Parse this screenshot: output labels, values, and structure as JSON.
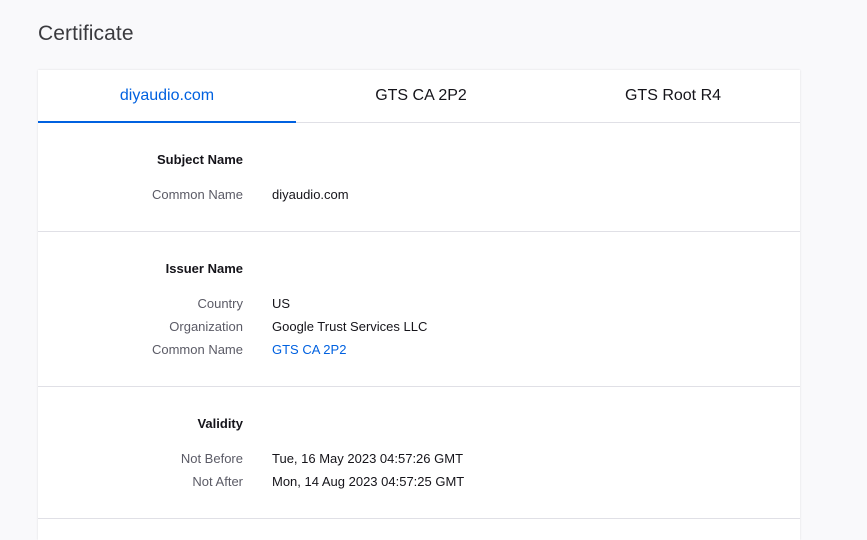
{
  "page": {
    "title": "Certificate"
  },
  "tabs": [
    {
      "label": "diyaudio.com",
      "active": true
    },
    {
      "label": "GTS CA 2P2",
      "active": false
    },
    {
      "label": "GTS Root R4",
      "active": false
    }
  ],
  "subject": {
    "heading": "Subject Name",
    "common_name": {
      "label": "Common Name",
      "value": "diyaudio.com"
    }
  },
  "issuer": {
    "heading": "Issuer Name",
    "country": {
      "label": "Country",
      "value": "US"
    },
    "organization": {
      "label": "Organization",
      "value": "Google Trust Services LLC"
    },
    "common_name": {
      "label": "Common Name",
      "value": "GTS CA 2P2"
    }
  },
  "validity": {
    "heading": "Validity",
    "not_before": {
      "label": "Not Before",
      "value": "Tue, 16 May 2023 04:57:26 GMT"
    },
    "not_after": {
      "label": "Not After",
      "value": "Mon, 14 Aug 2023 04:57:25 GMT"
    }
  },
  "colors": {
    "accent": "#0061e0",
    "label": "#5b5b66",
    "text": "#15141a",
    "divider": "#e0e0e6",
    "background": "#f9f9fb"
  }
}
